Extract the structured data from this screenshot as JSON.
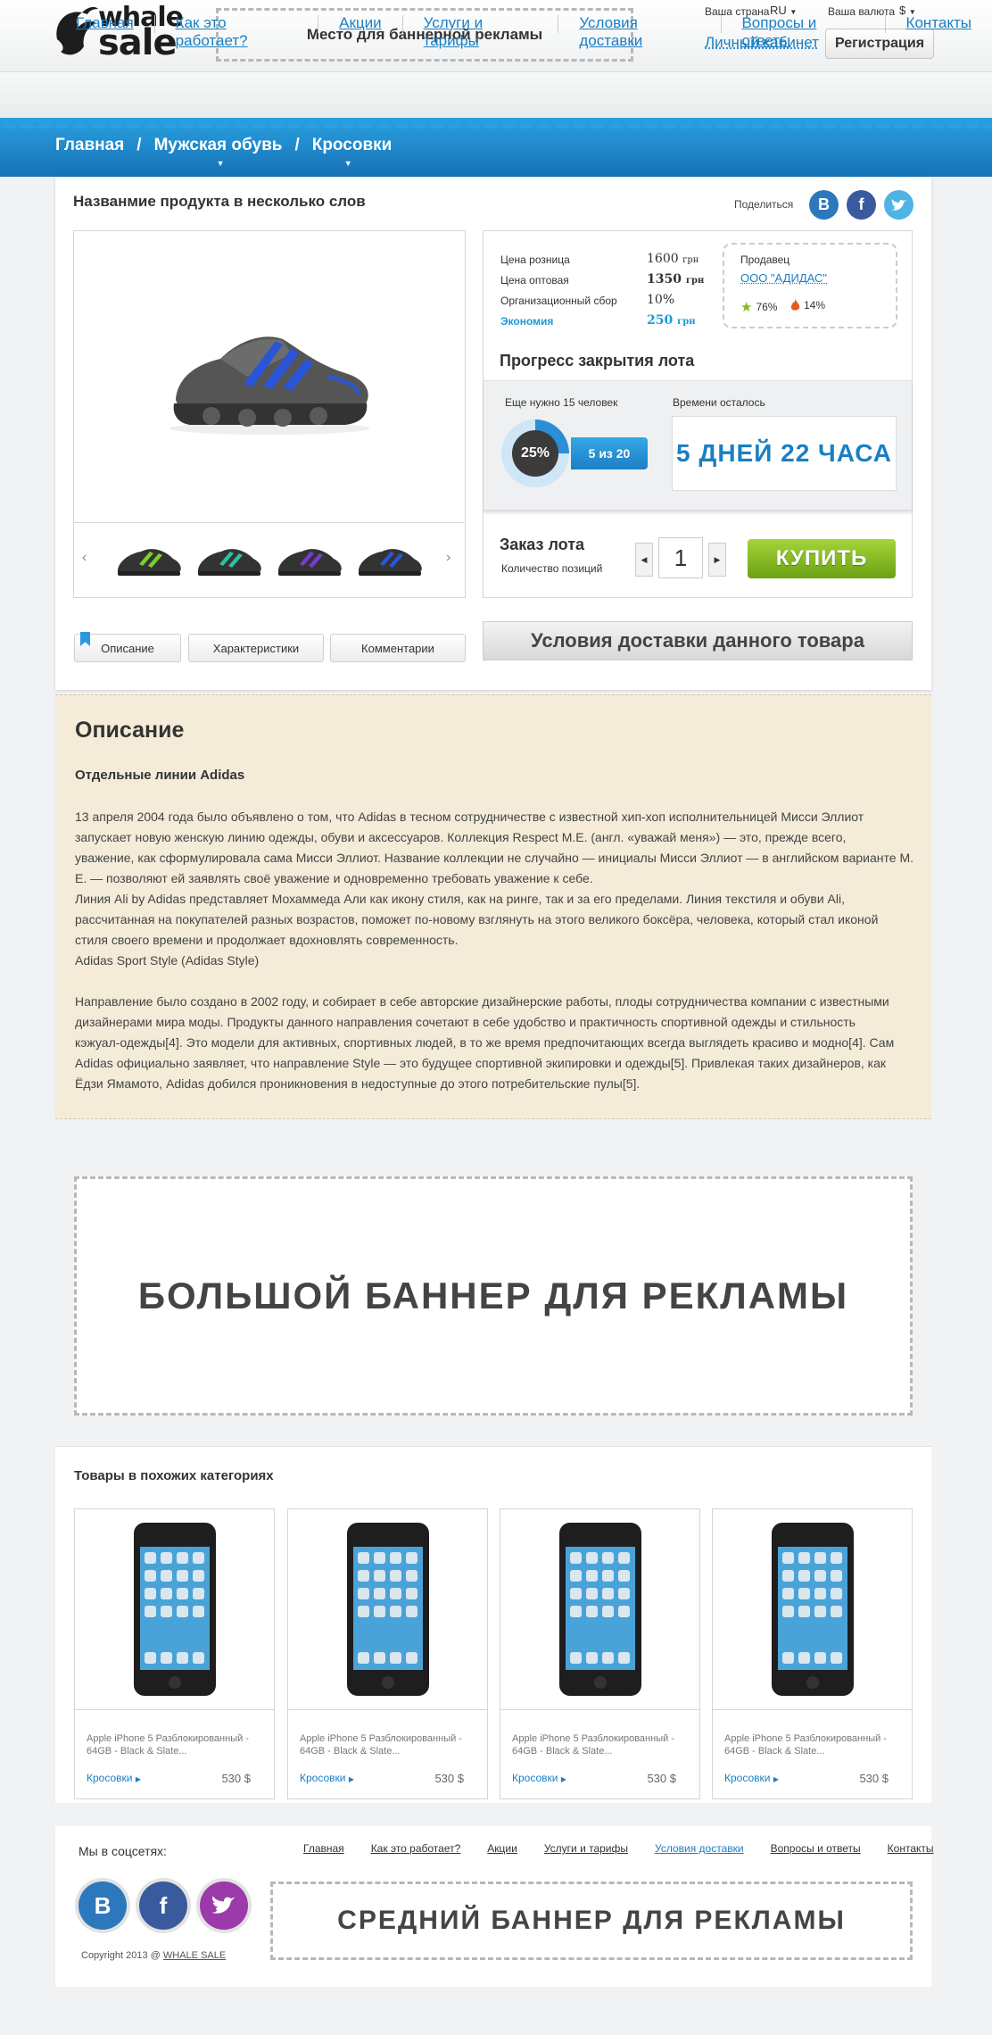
{
  "header": {
    "logo_line1": "whale",
    "logo_line2": "sale",
    "banner_text": "Место для баннерной рекламы",
    "country_label": "Ваша страна",
    "country_value": "RU",
    "currency_label": "Ваша валюта",
    "currency_value": "$",
    "cabinet_link": "Личный кабинет",
    "register_button": "Регистрация"
  },
  "nav": {
    "items": [
      "Главная",
      "Как это работает?",
      "Акции",
      "Услуги и тарифы",
      "Условия доставки",
      "Вопросы и ответы",
      "Контакты"
    ]
  },
  "breadcrumb": {
    "items": [
      "Главная",
      "Мужская обувь",
      "Кросовки"
    ],
    "separator": "/"
  },
  "product": {
    "title": "Названмие продукта в несколько слов",
    "share_label": "Поделиться",
    "prices": [
      {
        "label": "Цена розница",
        "value": "1600",
        "unit": "грн"
      },
      {
        "label": "Цена оптовая",
        "value": "1350",
        "unit": "грн"
      },
      {
        "label": "Организационный сбор",
        "value": "10%",
        "unit": ""
      },
      {
        "label": "Экономия",
        "value": "250",
        "unit": "грн"
      }
    ],
    "seller": {
      "label": "Продавец",
      "name": "ООО \"АДИДАС\"",
      "positive": "76%",
      "negative": "14%"
    },
    "progress": {
      "title": "Прогресс закрытия лота",
      "need_label": "Еще нужно 15 человек",
      "percent": "25%",
      "percent_value": 0.25,
      "count": "5 из 20",
      "time_label": "Времени осталось",
      "time_left": "5 ДНЕЙ 22 ЧАСА"
    },
    "order": {
      "title": "Заказ лота",
      "subtitle": "Количество позиций",
      "quantity": "1",
      "buy_button": "КУПИТЬ"
    },
    "tabs": [
      "Описание",
      "Характеристики",
      "Комментарии"
    ],
    "delivery_button": "Условия доставки данного товара"
  },
  "colors": {
    "accent": "#1a7fc4",
    "buy_green": "#7ab51d",
    "description_bg": "#f4ecd9",
    "wave_blue": "#1f88cf"
  },
  "description": {
    "title": "Описание",
    "subtitle": "Отдельные линии Adidas",
    "paragraph1_lines": [
      "13 апреля 2004 года было объявлено о том, что Adidas в тесном сотрудничестве с известной хип-хоп исполнительницей Мисси Эллиот",
      "запускает новую женскую линию одежды, обуви и аксессуаров. Коллекция Respect M.E. (англ. «уважай меня») — это, прежде всего,",
      "уважение, как сформулировала сама Мисси Эллиот. Название коллекции не случайно — инициалы Мисси Эллиот — в английском варианте M.",
      "E. — позволяют ей заявлять своё уважение и одновременно требовать уважение к себе.",
      "Линия Ali by Adidas представляет Мохаммеда Али как икону стиля, как на ринге, так и за его пределами. Линия текстиля и обуви Ali,",
      "рассчитанная на покупателей разных возрастов, поможет по-новому взглянуть на этого великого боксёра, человека, который стал иконой",
      "стиля своего времени и продолжает вдохновлять современность.",
      "Adidas Sport Style (Adidas Style)"
    ],
    "paragraph2_lines": [
      "Направление было создано в 2002 году, и собирает в себе авторские дизайнерские работы, плоды сотрудничества компании с известными",
      "дизайнерами мира моды. Продукты данного направления сочетают в себе удобство и практичность спортивной одежды и стильность",
      "кэжуал-одежды[4]. Это модели для активных, спортивных людей, в то же время предпочитающих всегда выглядеть красиво и модно[4]. Сам",
      "Adidas официально заявляет, что направление Style — это будущее спортивной экипировки и одежды[5]. Привлекая таких дизайнеров, как",
      "Ёдзи Ямамото, Adidas добился проникновения в недоступные до этого потребительские пулы[5]."
    ]
  },
  "big_banner": "БОЛЬШОЙ БАННЕР ДЛЯ РЕКЛАМЫ",
  "similar": {
    "title": "Товары в похожих категориях",
    "items": [
      {
        "name": "Apple iPhone 5 Разблокированный - 64GB - Black & Slate...",
        "category": "Кросовки",
        "price": "530 $"
      },
      {
        "name": "Apple iPhone 5 Разблокированный - 64GB - Black & Slate...",
        "category": "Кросовки",
        "price": "530 $"
      },
      {
        "name": "Apple iPhone 5 Разблокированный - 64GB - Black & Slate...",
        "category": "Кросовки",
        "price": "530 $"
      },
      {
        "name": "Apple iPhone 5 Разблокированный - 64GB - Black & Slate...",
        "category": "Кросовки",
        "price": "530 $"
      }
    ]
  },
  "footer": {
    "social_label": "Мы в соцсетях:",
    "nav": [
      "Главная",
      "Как это работает?",
      "Акции",
      "Услуги и тарифы",
      "Условия доставки",
      "Вопросы и ответы",
      "Контакты"
    ],
    "mid_banner": "СРЕДНИЙ БАННЕР ДЛЯ РЕКЛАМЫ",
    "copyright_prefix": "Copyright 2013 @",
    "copyright_brand": "WHALE SALE"
  },
  "icons": [
    "whale-logo-icon",
    "caret-down-icon",
    "vk-icon",
    "facebook-icon",
    "twitter-icon",
    "star-icon",
    "fire-icon",
    "arrow-left-icon",
    "arrow-right-icon",
    "bookmark-icon"
  ]
}
